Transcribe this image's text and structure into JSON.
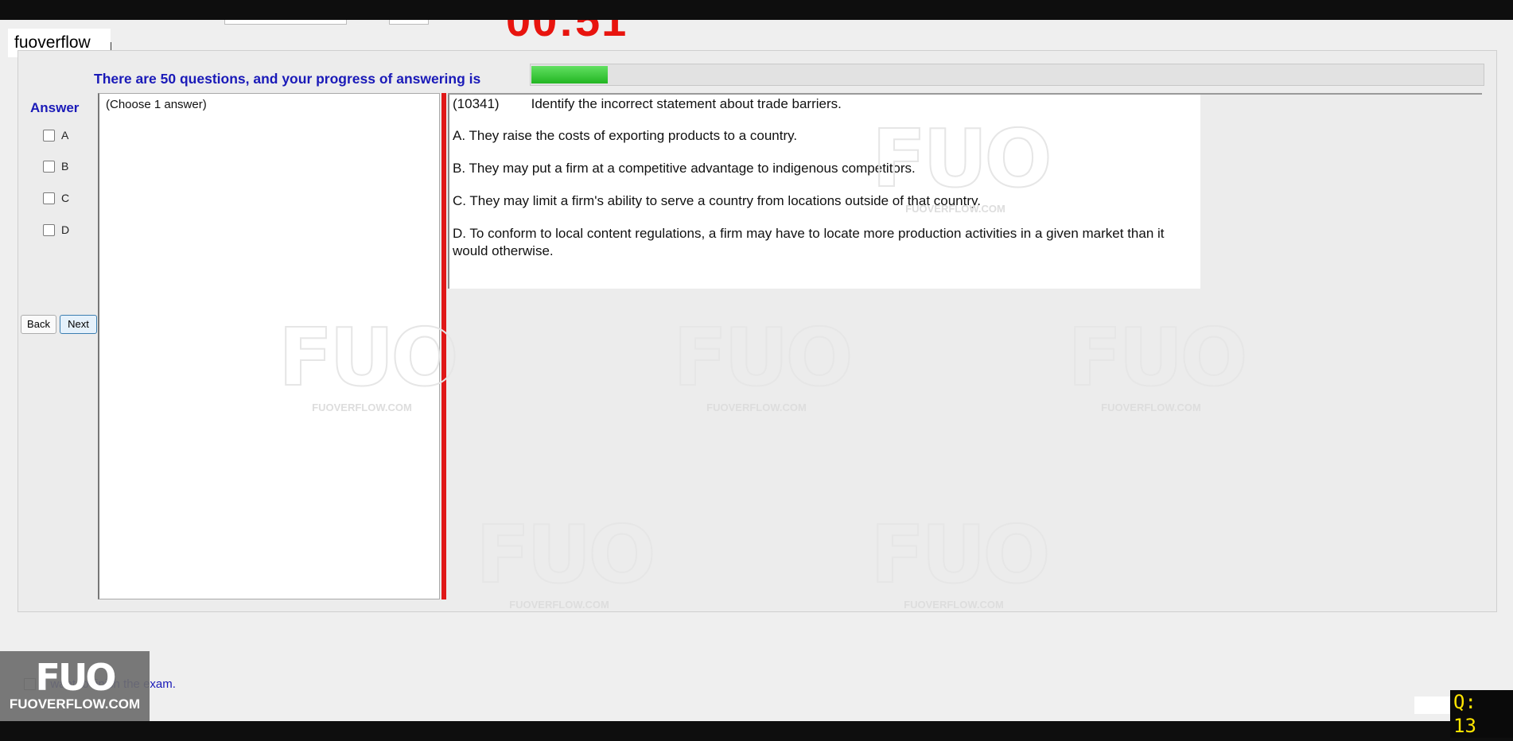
{
  "app": {
    "brand": "fuoverflow",
    "timer": "00:51"
  },
  "progress": {
    "label": "There are 50 questions, and your progress of answering is",
    "fraction": 0.08
  },
  "answer": {
    "title": "Answer",
    "options": [
      "A",
      "B",
      "C",
      "D"
    ],
    "choose_hint": "(Choose 1 answer)"
  },
  "nav": {
    "back_label": "Back",
    "next_label": "Next"
  },
  "question": {
    "id": "(10341)",
    "text": "Identify the incorrect statement about trade barriers.",
    "options": [
      "A.  They raise the costs of exporting products to a country.",
      "B.  They may put a firm at a competitive advantage to indigenous competitors.",
      "C.  They may limit a firm's ability to serve a country from locations outside of that country.",
      "D.  To conform to local content regulations, a firm may have to locate more production activities in a given market than it would otherwise."
    ]
  },
  "finish": {
    "label": "I want to finish the exam."
  },
  "watermark": {
    "logo": "FUO",
    "site": "FUOVERFLOW.COM"
  },
  "counter": {
    "text": "Q: 13"
  }
}
